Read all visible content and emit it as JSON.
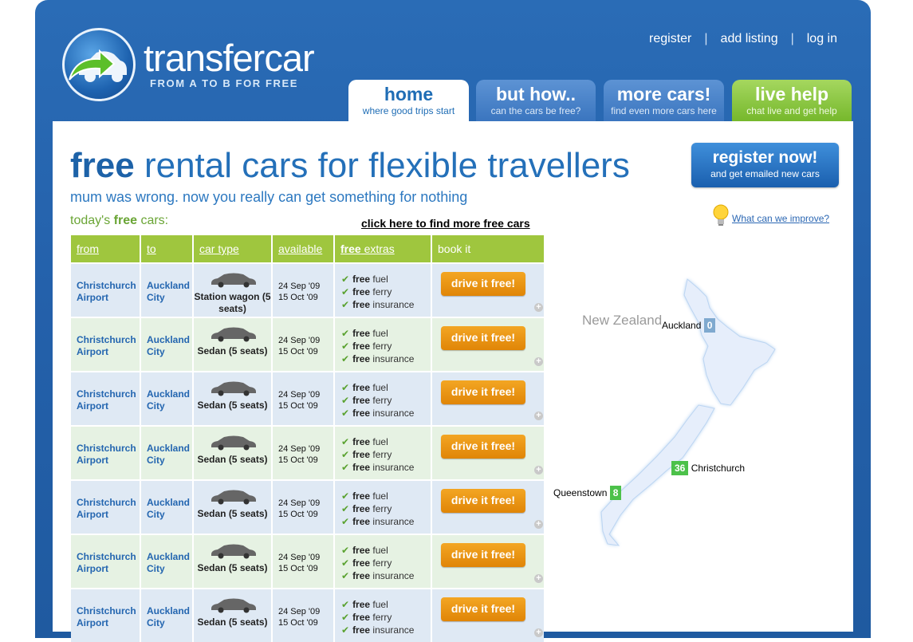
{
  "brand": {
    "name": "transfercar",
    "tagline": "FROM A TO B FOR FREE"
  },
  "top_links": [
    "register",
    "add listing",
    "log in"
  ],
  "tabs": [
    {
      "title": "home",
      "subtitle": "where good trips start"
    },
    {
      "title": "but how..",
      "subtitle": "can the cars be free?"
    },
    {
      "title": "more cars!",
      "subtitle": "find even more cars here"
    },
    {
      "title": "live help",
      "subtitle": "chat live and get help"
    }
  ],
  "headline": {
    "bold": "free",
    "rest": " rental cars for flexible travellers"
  },
  "subheadline": "mum was wrong. now you really can get something for nothing",
  "today": {
    "prefix": "today's ",
    "bold": "free",
    "suffix": " cars:"
  },
  "more_link": "click here to find more free cars",
  "register_button": {
    "title": "register now!",
    "subtitle": "and get emailed new cars"
  },
  "improve_link": "What can we improve?",
  "table": {
    "headers": {
      "from": "from",
      "to": "to",
      "car_type": "car type",
      "available": "available",
      "extras_bold": "free",
      "extras": " extras",
      "book": "book it"
    },
    "book_label": "drive it free!",
    "extras": [
      {
        "bold": "free",
        "text": " fuel"
      },
      {
        "bold": "free",
        "text": " ferry"
      },
      {
        "bold": "free",
        "text": " insurance"
      }
    ],
    "rows": [
      {
        "from": "Christchurch Airport",
        "to": "Auckland City",
        "car": "Station wagon (5 seats)",
        "d1": "24 Sep '09",
        "d2": "15 Oct '09"
      },
      {
        "from": "Christchurch Airport",
        "to": "Auckland City",
        "car": "Sedan (5 seats)",
        "d1": "24 Sep '09",
        "d2": "15 Oct '09"
      },
      {
        "from": "Christchurch Airport",
        "to": "Auckland City",
        "car": "Sedan (5 seats)",
        "d1": "24 Sep '09",
        "d2": "15 Oct '09"
      },
      {
        "from": "Christchurch Airport",
        "to": "Auckland City",
        "car": "Sedan (5 seats)",
        "d1": "24 Sep '09",
        "d2": "15 Oct '09"
      },
      {
        "from": "Christchurch Airport",
        "to": "Auckland City",
        "car": "Sedan (5 seats)",
        "d1": "24 Sep '09",
        "d2": "15 Oct '09"
      },
      {
        "from": "Christchurch Airport",
        "to": "Auckland City",
        "car": "Sedan (5 seats)",
        "d1": "24 Sep '09",
        "d2": "15 Oct '09"
      },
      {
        "from": "Christchurch Airport",
        "to": "Auckland City",
        "car": "Sedan (5 seats)",
        "d1": "24 Sep '09",
        "d2": "15 Oct '09"
      }
    ]
  },
  "map": {
    "title": "New Zealand",
    "locations": [
      {
        "name": "Auckland",
        "count": "0",
        "color": "#7fa9cf"
      },
      {
        "name": "Christchurch",
        "count": "36",
        "color": "#4cc14a"
      },
      {
        "name": "Queenstown",
        "count": "8",
        "color": "#4cc14a"
      }
    ]
  },
  "colors": {
    "brand_blue": "#2461ab",
    "table_header_green": "#9fc63e",
    "button_orange": "#e08507"
  }
}
